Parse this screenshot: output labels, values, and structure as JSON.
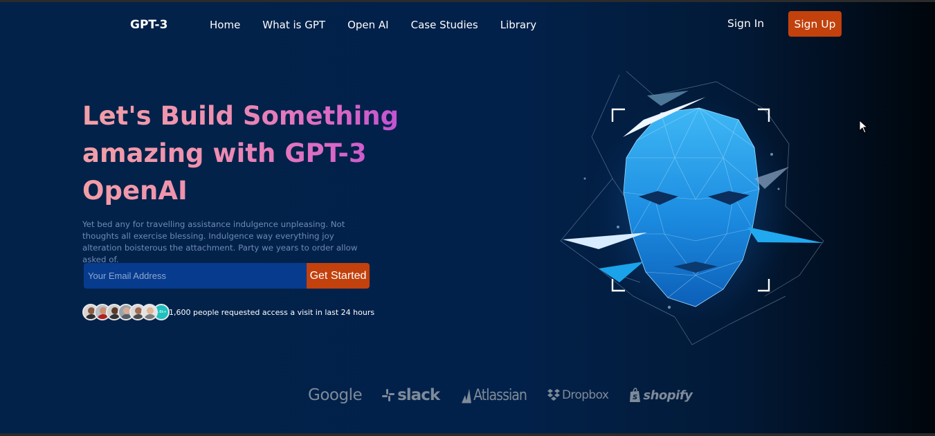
{
  "nav": {
    "logo": "GPT-3",
    "links": [
      "Home",
      "What is GPT",
      "Open AI",
      "Case Studies",
      "Library"
    ],
    "sign_in": "Sign In",
    "sign_up": "Sign Up"
  },
  "hero": {
    "headline_line1": "Let's Build Something",
    "headline_line2": "amazing with GPT-3",
    "headline_line3": "OpenAI",
    "subtext": "Yet bed any for travelling assistance indulgence unpleasing. Not thoughts all exercise blessing. Indulgence way everything joy alteration boisterous the attachment. Party we years to order allow asked of.",
    "email_placeholder": "Your Email Address",
    "cta": "Get Started",
    "avatar_more": "1.6k+",
    "access_text": "1,600 people requested access a visit in last 24 hours"
  },
  "brands": [
    "Google",
    "slack",
    "Atlassian",
    "Dropbox",
    "shopify"
  ],
  "colors": {
    "accent": "#c2410c",
    "background": "#02224a",
    "input_bg": "#073b8e",
    "headline_gradient": [
      "#f2a0a5",
      "#d866c6",
      "#b547d8"
    ],
    "brand_logo": "#7e8b99"
  }
}
